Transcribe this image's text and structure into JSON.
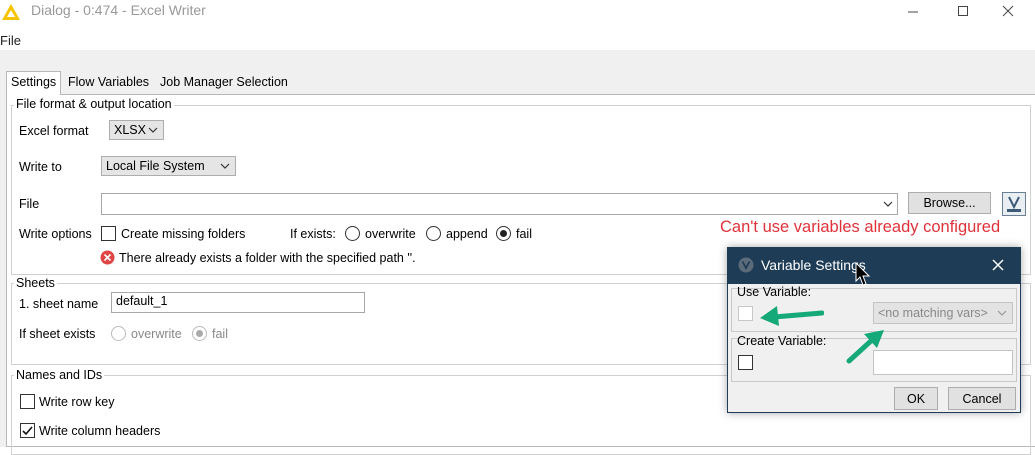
{
  "window": {
    "title": "Dialog - 0:474 - Excel Writer"
  },
  "menu": {
    "file": "File"
  },
  "tabs": [
    {
      "label": "Settings",
      "active": true
    },
    {
      "label": "Flow Variables",
      "active": false
    },
    {
      "label": "Job Manager Selection",
      "active": false
    }
  ],
  "file_group": {
    "title": "File format & output location",
    "excel_format_label": "Excel format",
    "excel_format_value": "XLSX",
    "write_to_label": "Write to",
    "write_to_value": "Local File System",
    "file_label": "File",
    "file_value": "",
    "browse_label": "Browse...",
    "write_options_label": "Write options",
    "create_missing_folders_label": "Create missing folders",
    "create_missing_folders_checked": false,
    "if_exists_label": "If exists:",
    "if_exists_options": [
      "overwrite",
      "append",
      "fail"
    ],
    "if_exists_selected": "fail",
    "error_message": "There already exists a folder with the specified path ''."
  },
  "sheets_group": {
    "title": "Sheets",
    "sheet_name_label": "1. sheet name",
    "sheet_name_value": "default_1",
    "if_sheet_exists_label": "If sheet exists",
    "options": [
      "overwrite",
      "fail"
    ],
    "selected": "fail"
  },
  "names_group": {
    "title": "Names and IDs",
    "write_row_key_label": "Write row key",
    "write_row_key_checked": false,
    "write_column_headers_label": "Write column headers",
    "write_column_headers_checked": true
  },
  "annotation": "Can't use variables already configured",
  "variable_dialog": {
    "title": "Variable Settings",
    "use_variable_label": "Use Variable:",
    "use_variable_checked": false,
    "dropdown_value": "<no matching vars>",
    "create_variable_label": "Create Variable:",
    "create_variable_checked": false,
    "ok_label": "OK",
    "cancel_label": "Cancel"
  },
  "colors": {
    "dialog_header": "#1f3c56",
    "annotation_red": "#e0323a",
    "arrow_green": "#15a878",
    "error_red": "#e04545"
  }
}
